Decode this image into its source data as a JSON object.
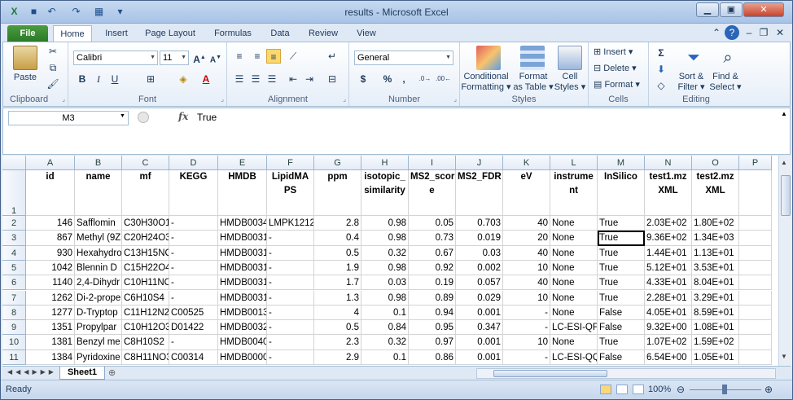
{
  "window": {
    "title": "results  -  Microsoft Excel"
  },
  "tabs": [
    "File",
    "Home",
    "Insert",
    "Page Layout",
    "Formulas",
    "Data",
    "Review",
    "View"
  ],
  "ribbon": {
    "clipboard": {
      "label": "Clipboard",
      "paste": "Paste"
    },
    "font": {
      "label": "Font",
      "name": "Calibri",
      "size": "11",
      "bold": "B",
      "italic": "I",
      "underline": "U"
    },
    "alignment": {
      "label": "Alignment"
    },
    "number": {
      "label": "Number",
      "format": "General",
      "currency": "$",
      "percent": "%",
      "comma": ","
    },
    "styles": {
      "label": "Styles",
      "conditional": "Conditional",
      "conditional2": "Formatting",
      "format_table": "Format",
      "format_table2": "as Table",
      "cell_styles": "Cell",
      "cell_styles2": "Styles"
    },
    "cells": {
      "label": "Cells",
      "insert": "Insert",
      "delete": "Delete",
      "format": "Format"
    },
    "editing": {
      "label": "Editing",
      "sort": "Sort &",
      "sort2": "Filter",
      "find": "Find &",
      "find2": "Select"
    }
  },
  "formula_bar": {
    "name_box": "M3",
    "fx": "fx",
    "value": "True"
  },
  "columns": [
    "A",
    "B",
    "C",
    "D",
    "E",
    "F",
    "G",
    "H",
    "I",
    "J",
    "K",
    "L",
    "M",
    "N",
    "O",
    "P"
  ],
  "header_row": [
    "id",
    "name",
    "mf",
    "KEGG",
    "HMDB",
    "LipidMAPS",
    "ppm",
    "isotopic_similarity",
    "MS2_score",
    "MS2_FDR",
    "eV",
    "instrument",
    "InSilico",
    "test1.mzXML",
    "test2.mzXML",
    ""
  ],
  "header_display": [
    "id",
    "name",
    "mf",
    "KEGG",
    "HMDB",
    "LipidMA PS",
    "ppm",
    "isotopic_ similarity",
    "MS2_scor e",
    "MS2_FDR",
    "eV",
    "instrume nt",
    "InSilico",
    "test1.mz XML",
    "test2.mz XML",
    ""
  ],
  "rows": [
    [
      "146",
      "Safflomin",
      "C30H30O1",
      "-",
      "HMDB0034",
      "LMPK1212",
      "2.8",
      "0.98",
      "0.05",
      "0.703",
      "40",
      "None",
      "True",
      "2.03E+02",
      "1.80E+02"
    ],
    [
      "867",
      "Methyl (9Z",
      "C20H24O3",
      "-",
      "HMDB0031",
      "-",
      "0.4",
      "0.98",
      "0.73",
      "0.019",
      "20",
      "None",
      "True",
      "9.36E+02",
      "1.34E+03"
    ],
    [
      "930",
      "Hexahydro",
      "C13H15NO",
      "-",
      "HMDB0031",
      "-",
      "0.5",
      "0.32",
      "0.67",
      "0.03",
      "40",
      "None",
      "True",
      "1.44E+01",
      "1.13E+01"
    ],
    [
      "1042",
      "Blennin D",
      "C15H22O4",
      "-",
      "HMDB0031",
      "-",
      "1.9",
      "0.98",
      "0.92",
      "0.002",
      "10",
      "None",
      "True",
      "5.12E+01",
      "3.53E+01"
    ],
    [
      "1140",
      "2,4-Dihydr",
      "C10H11NO",
      "-",
      "HMDB0031",
      "-",
      "1.7",
      "0.03",
      "0.19",
      "0.057",
      "40",
      "None",
      "True",
      "4.33E+01",
      "8.04E+01"
    ],
    [
      "1262",
      "Di-2-prope",
      "C6H10S4",
      "-",
      "HMDB0031",
      "-",
      "1.3",
      "0.98",
      "0.89",
      "0.029",
      "10",
      "None",
      "True",
      "2.28E+01",
      "3.29E+01"
    ],
    [
      "1277",
      "D-Tryptop",
      "C11H12N2",
      "C00525",
      "HMDB0013",
      "-",
      "4",
      "0.1",
      "0.94",
      "0.001",
      "-",
      "None",
      "False",
      "4.05E+01",
      "8.59E+01"
    ],
    [
      "1351",
      "Propylpar",
      "C10H12O3",
      "D01422",
      "HMDB0032",
      "-",
      "0.5",
      "0.84",
      "0.95",
      "0.347",
      "-",
      "LC-ESI-QFT",
      "False",
      "9.32E+00",
      "1.08E+01"
    ],
    [
      "1381",
      "Benzyl me",
      "C8H10S2",
      "-",
      "HMDB0040",
      "-",
      "2.3",
      "0.32",
      "0.97",
      "0.001",
      "10",
      "None",
      "True",
      "1.07E+02",
      "1.59E+02"
    ],
    [
      "1384",
      "Pyridoxine",
      "C8H11NO3",
      "C00314",
      "HMDB0000",
      "-",
      "2.9",
      "0.1",
      "0.86",
      "0.001",
      "-",
      "LC-ESI-QQ",
      "False",
      "6.54E+00",
      "1.05E+01"
    ]
  ],
  "row_numbers": [
    "1",
    "2",
    "3",
    "4",
    "5",
    "6",
    "7",
    "8",
    "9",
    "10",
    "11"
  ],
  "sheet_tab": "Sheet1",
  "status": {
    "ready": "Ready",
    "zoom": "100%"
  },
  "colors": {
    "file_tab": "#2b7a27",
    "selection": "#dbe5f1",
    "grid": "#d4d4d4"
  }
}
